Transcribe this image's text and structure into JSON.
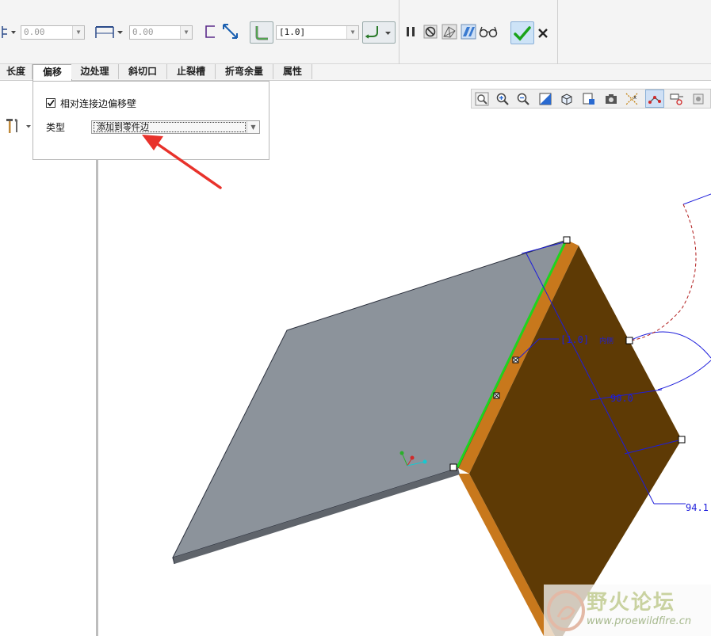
{
  "toolbar": {
    "field1_value": "0.00",
    "field2_value": "0.00",
    "thickness_value": "[1.0]"
  },
  "tabs": [
    {
      "label": "长度"
    },
    {
      "label": "偏移"
    },
    {
      "label": "边处理"
    },
    {
      "label": "斜切口"
    },
    {
      "label": "止裂槽"
    },
    {
      "label": "折弯余量"
    },
    {
      "label": "属性"
    }
  ],
  "active_tab": "偏移",
  "panel": {
    "checkbox_label": "相对连接边偏移壁",
    "checkbox_checked": true,
    "type_label": "类型",
    "type_value": "添加到零件边"
  },
  "model": {
    "dim_thickness": "[1.0]",
    "dim_thickness_side": "内侧",
    "dim_angle": "90.0",
    "dim_length": "94.1"
  },
  "watermark": {
    "title": "野火论坛",
    "url": "www.proewildfire.cn"
  },
  "colors": {
    "flat_face": "#8c939b",
    "flange_face": "#5e3a05",
    "flange_edge": "#c8781c",
    "highlight_edge": "#1fd41f",
    "dimension": "#1d1ddb",
    "arrow": "#e8322b",
    "accept": "#1aa31a"
  }
}
